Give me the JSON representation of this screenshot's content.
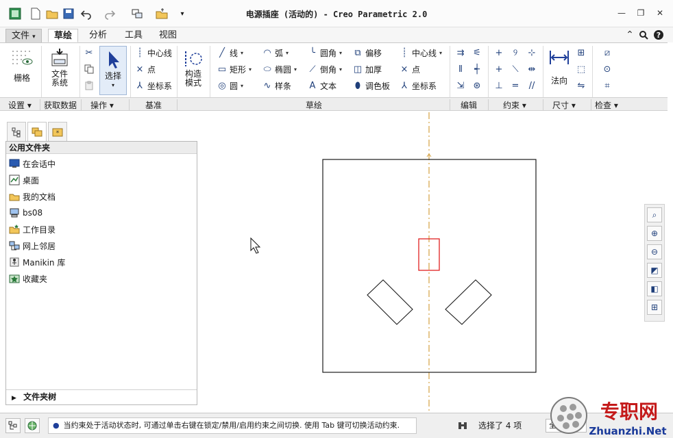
{
  "app": {
    "title": "电源插座 (活动的) - Creo Parametric 2.0"
  },
  "tabs": [
    {
      "label": "文件",
      "dropdown": "▾"
    },
    {
      "label": "草绘"
    },
    {
      "label": "分析"
    },
    {
      "label": "工具"
    },
    {
      "label": "视图"
    }
  ],
  "ribbon": {
    "grid_label": "栅格",
    "file_system_label1": "文件",
    "file_system_label2": "系统",
    "select_label": "选择",
    "datum": {
      "centerline": "中心线",
      "point": "点",
      "csys": "坐标系"
    },
    "construct_label1": "构造",
    "construct_label2": "模式",
    "sketch": {
      "line": "线",
      "rect": "矩形",
      "circle": "圆",
      "arc": "弧",
      "ellipse": "椭圆",
      "spline": "样条",
      "fillet": "圆角",
      "chamfer": "倒角",
      "text": "文本",
      "offset": "偏移",
      "thicken": "加厚",
      "palette": "调色板",
      "centerline": "中心线",
      "point": "点",
      "csys": "坐标系"
    },
    "normal_label": "法向"
  },
  "groups": {
    "settings": "设置",
    "get_data": "获取数据",
    "operations": "操作",
    "datum": "基准",
    "sketching": "草绘",
    "editing": "编辑",
    "constrain": "约束",
    "dimension": "尺寸",
    "inspect": "检查"
  },
  "navigator": {
    "header": "公用文件夹",
    "items": [
      {
        "label": "在会话中",
        "icon": "session-icon"
      },
      {
        "label": "桌面",
        "icon": "desktop-icon"
      },
      {
        "label": "我的文档",
        "icon": "documents-icon"
      },
      {
        "label": "bs08",
        "icon": "computer-icon"
      },
      {
        "label": "工作目录",
        "icon": "working-dir-icon"
      },
      {
        "label": "网上邻居",
        "icon": "network-icon"
      },
      {
        "label": "Manikin 库",
        "icon": "manikin-icon"
      },
      {
        "label": "收藏夹",
        "icon": "favorites-icon"
      }
    ],
    "folder_tree": "文件夹树"
  },
  "status": {
    "message": "当约束处于活动状态时, 可通过单击右键在锁定/禁用/启用约束之间切换. 使用 Tab 键可切换活动约束.",
    "selection": "选择了 4 项",
    "filter": "全部"
  },
  "watermark": {
    "cn": "专职网",
    "url": "Zhuanzhi.Net"
  },
  "colors": {
    "accent": "#1f3f9a",
    "sketch_line": "#1a1a1a",
    "selected": "#e02020",
    "centerline": "#d4a040"
  }
}
